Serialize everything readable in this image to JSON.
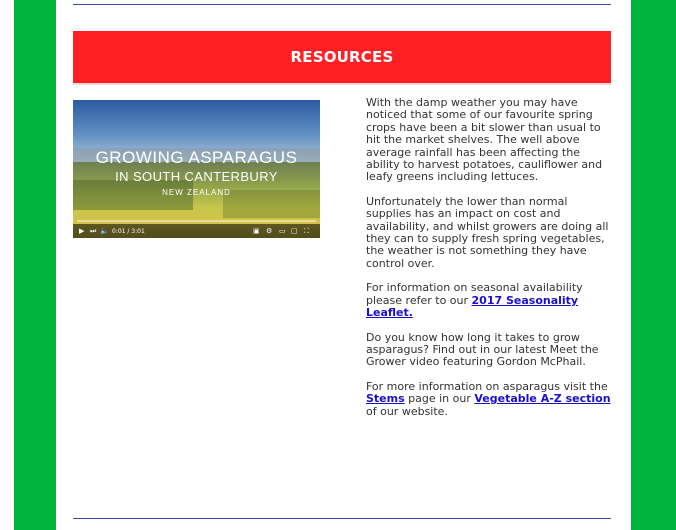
{
  "banner": {
    "title": "RESOURCES"
  },
  "video": {
    "title_line1": "GROWING ASPARAGUS",
    "title_line2": "IN SOUTH CANTERBURY",
    "title_line3": "NEW ZEALAND",
    "time": "0:01 / 3:01",
    "progress": 0.01
  },
  "content": {
    "p1": "With the damp weather you may have noticed that some of our favourite spring crops have been a bit slower than usual to hit the market shelves.  The well above average rainfall has been affecting the ability to harvest potatoes, cauliflower and leafy greens including lettuces.",
    "p2": "Unfortunately the lower than normal supplies has an impact on cost and availability, and whilst growers are doing all they can to supply fresh spring vegetables, the weather is not something they have control over.",
    "p3_prefix": "For information on seasonal availability please refer to our ",
    "p3_link": "2017 Seasonality Leaflet.",
    "p4": "Do you know how long it takes to grow asparagus?  Find out in our latest Meet the Grower video featuring Gordon McPhail.",
    "p5_prefix": "For more information on asparagus visit the ",
    "p5_link1": "Stems",
    "p5_mid": " page in our ",
    "p5_link2": "Vegetable A-Z section ",
    "p5_suffix": "of our website."
  },
  "colors": {
    "side_green": "#00b43c",
    "banner_red": "#ff1f25",
    "link_blue": "#1a10cc",
    "rule_blue": "#3a4aa8"
  }
}
